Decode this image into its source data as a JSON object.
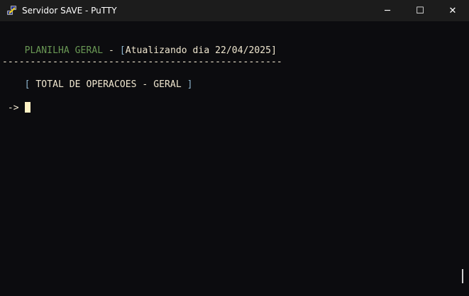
{
  "window": {
    "title": "Servidor SAVE - PuTTY",
    "minimize": "─",
    "maximize": "☐",
    "close": "✕"
  },
  "terminal": {
    "title_label": "PLANILHA GERAL",
    "title_sep": " - ",
    "title_open": "[",
    "title_update": "Atualizando dia 22/04/2025",
    "title_close": "]",
    "separator": "--------------------------------------------------",
    "section_open": "[",
    "section_label": " TOTAL DE OPERACOES - GERAL ",
    "section_close": "]",
    "prompt": "->"
  }
}
